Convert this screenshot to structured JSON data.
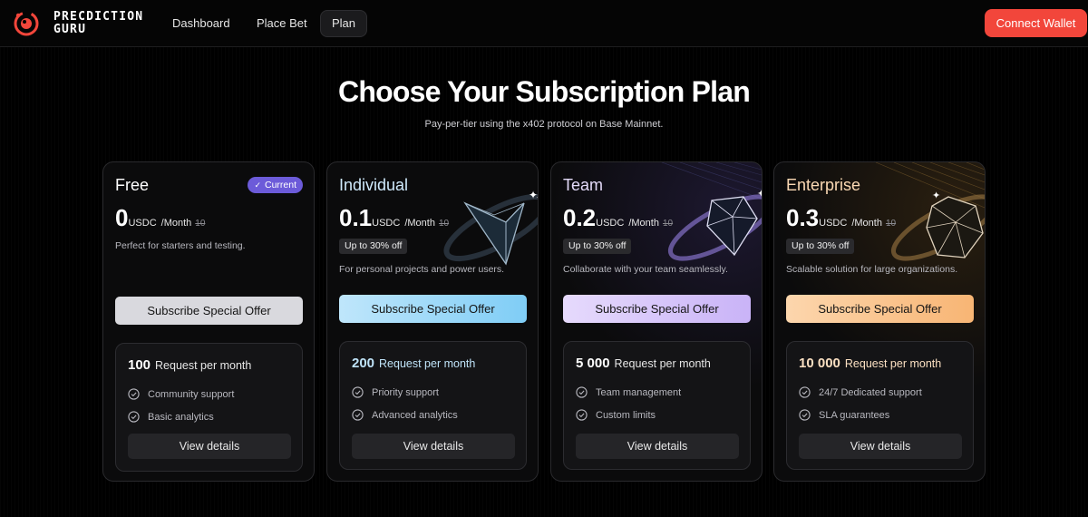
{
  "nav": {
    "brand": "PRECDICTION GURU",
    "links": [
      "Dashboard",
      "Place Bet",
      "Plan"
    ],
    "connect_label": "Connect Wallet",
    "accent_color": "#f2463b"
  },
  "header": {
    "title": "Choose Your Subscription Plan",
    "subtitle": "Pay-per-tier using the x402 protocol on Base Mainnet."
  },
  "plans": [
    {
      "name": "Free",
      "badge": "Current",
      "price": "0",
      "currency": "USDC",
      "period": "/Month",
      "old_price": "10",
      "description": "Perfect for starters and testing.",
      "button_label": "Subscribe Special Offer",
      "requests": "100",
      "requests_label": "Request per month",
      "features": [
        "Community support",
        "Basic analytics"
      ],
      "details_label": "View details",
      "button_color": "#d9d9de"
    },
    {
      "name": "Individual",
      "price": "0.1",
      "currency": "USDC",
      "period": "/Month",
      "old_price": "10",
      "discount": "Up to 30% off",
      "description": "For personal projects and power users.",
      "button_label": "Subscribe Special Offer",
      "requests": "200",
      "requests_label": "Request per month",
      "features": [
        "Priority support",
        "Advanced analytics"
      ],
      "details_label": "View details",
      "button_color": "#8fd4f7"
    },
    {
      "name": "Team",
      "price": "0.2",
      "currency": "USDC",
      "period": "/Month",
      "old_price": "10",
      "discount": "Up to 30% off",
      "description": "Collaborate with your team seamlessly.",
      "button_label": "Subscribe Special Offer",
      "requests": "5 000",
      "requests_label": "Request per month",
      "features": [
        "Team management",
        "Custom limits"
      ],
      "details_label": "View details",
      "button_color": "#d9c8fb"
    },
    {
      "name": "Enterprise",
      "price": "0.3",
      "currency": "USDC",
      "period": "/Month",
      "old_price": "10",
      "discount": "Up to 30% off",
      "description": "Scalable solution for large organizations.",
      "button_label": "Subscribe Special Offer",
      "requests": "10 000",
      "requests_label": "Request per month",
      "features": [
        "24/7 Dedicated support",
        "SLA guarantees"
      ],
      "details_label": "View details",
      "button_color": "#fbc995"
    }
  ]
}
